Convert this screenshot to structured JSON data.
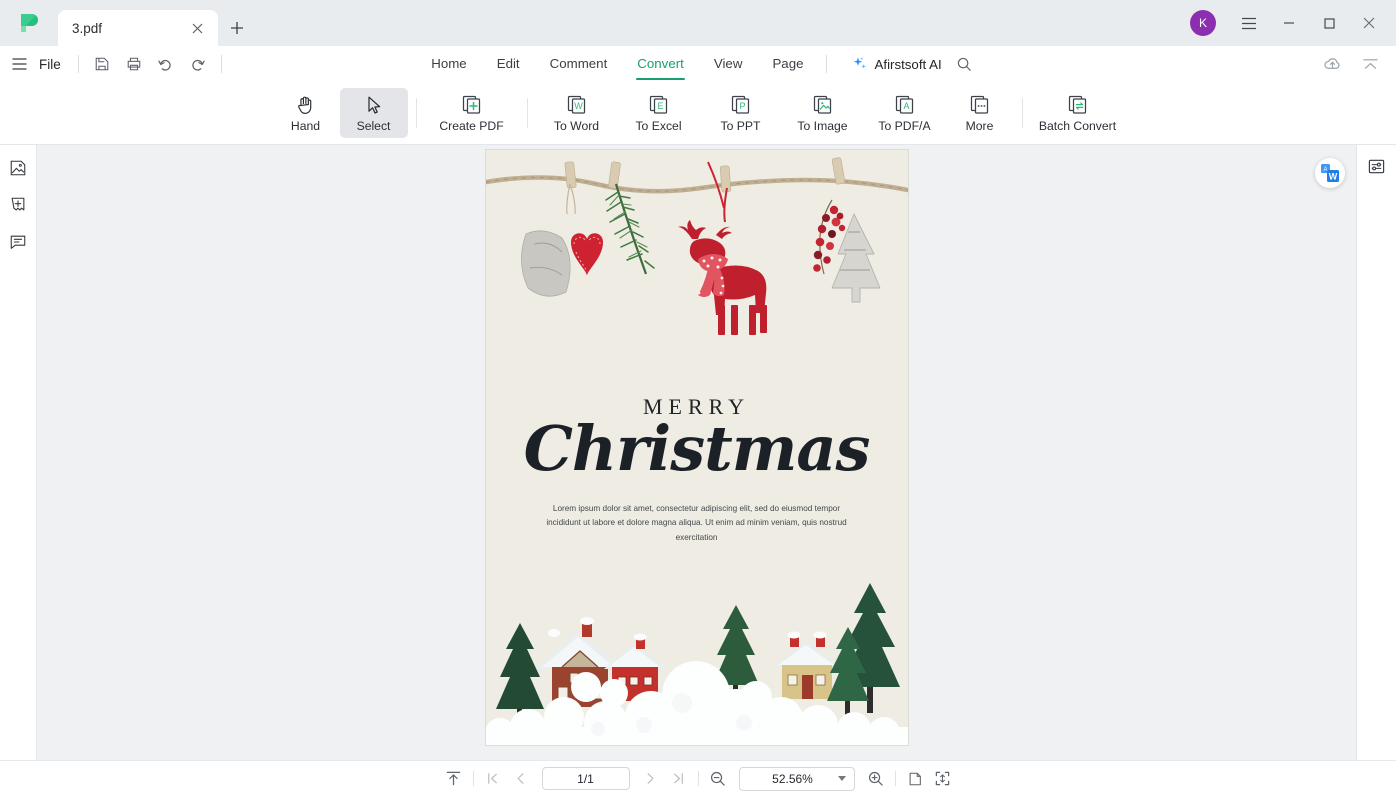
{
  "window": {
    "tab_title": "3.pdf",
    "new_tab_label": "+",
    "close_label": "✕",
    "avatar_initial": "K",
    "minimize_label": "—",
    "maximize_label": "□",
    "close_window_label": "✕",
    "logo_name": "afirstsoft-logo"
  },
  "menubar": {
    "file_label": "File",
    "quick_actions": [
      "save-icon",
      "print-icon",
      "undo-icon",
      "redo-icon"
    ],
    "items": [
      {
        "label": "Home",
        "active": false
      },
      {
        "label": "Edit",
        "active": false
      },
      {
        "label": "Comment",
        "active": false
      },
      {
        "label": "Convert",
        "active": true
      },
      {
        "label": "View",
        "active": false
      },
      {
        "label": "Page",
        "active": false
      }
    ],
    "ai_label": "Afirstsoft AI",
    "search_icon": "search-icon",
    "cloud_icon": "cloud-upload-icon",
    "collapse_icon": "collapse-ribbon-icon"
  },
  "ribbon": {
    "tools": [
      {
        "label": "Hand",
        "icon": "hand-icon",
        "active": false
      },
      {
        "label": "Select",
        "icon": "cursor-select-icon",
        "active": true
      }
    ],
    "create": [
      {
        "label": "Create PDF",
        "icon": "create-pdf-icon"
      }
    ],
    "convert": [
      {
        "label": "To Word",
        "icon": "to-word-icon",
        "glyph": "W"
      },
      {
        "label": "To Excel",
        "icon": "to-excel-icon",
        "glyph": "E"
      },
      {
        "label": "To PPT",
        "icon": "to-ppt-icon",
        "glyph": "P"
      },
      {
        "label": "To Image",
        "icon": "to-image-icon",
        "glyph": "img"
      },
      {
        "label": "To PDF/A",
        "icon": "to-pdfa-icon",
        "glyph": "A"
      },
      {
        "label": "More",
        "icon": "more-convert-icon",
        "glyph": "..."
      }
    ],
    "batch": [
      {
        "label": "Batch Convert",
        "icon": "batch-convert-icon"
      }
    ],
    "highlight_color": "#ee2b20"
  },
  "sidebar_left": {
    "items": [
      {
        "name": "thumbnail-panel",
        "icon": "thumbnail-icon"
      },
      {
        "name": "bookmark-panel",
        "icon": "bookmark-add-icon"
      },
      {
        "name": "comment-panel",
        "icon": "comment-icon"
      }
    ]
  },
  "sidebar_right": {
    "items": [
      {
        "name": "properties-panel",
        "icon": "sliders-icon"
      }
    ]
  },
  "document": {
    "heading_small": "MERRY",
    "heading_large": "Christmas",
    "body_text": "Lorem ipsum dolor sit amet, consectetur adipiscing elit, sed do eiusmod tempor incididunt ut labore et dolore magna aliqua. Ut enim ad minim veniam, quis nostrud exercitation",
    "top_image_alt": "christmas-ornaments-on-rope",
    "bottom_image_alt": "snowy-village-scene",
    "page_background": "#eeece3"
  },
  "float_button": {
    "name": "translate-to-word-button",
    "glyph": "W"
  },
  "statusbar": {
    "fit_top_icon": "scroll-to-top-icon",
    "first_page_icon": "first-page-icon",
    "prev_page_icon": "previous-page-icon",
    "page_value": "1/1",
    "next_page_icon": "next-page-icon",
    "last_page_icon": "last-page-icon",
    "zoom_out_icon": "zoom-out-icon",
    "zoom_value": "52.56%",
    "zoom_in_icon": "zoom-in-icon",
    "single_page_icon": "single-page-view-icon",
    "fit_page_icon": "fit-page-icon"
  }
}
